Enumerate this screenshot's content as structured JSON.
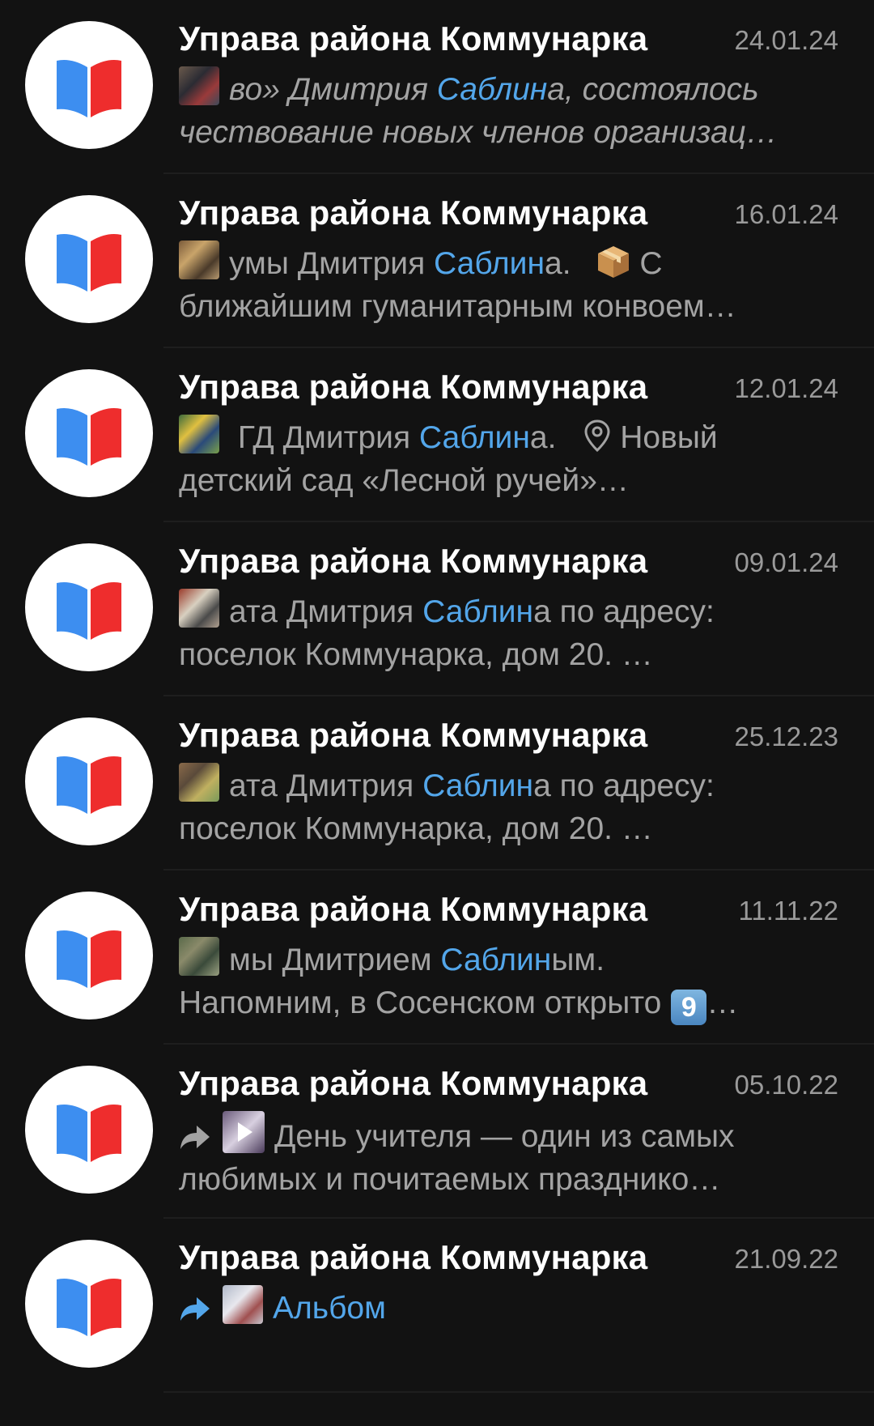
{
  "chats": [
    {
      "title": "Управа района Коммунарка",
      "date": "24.01.24",
      "line1_pre": "во» Дмитрия ",
      "line1_hl": "Саблин",
      "line1_post": "а, состоялось",
      "line2": "чествование новых членов организац…"
    },
    {
      "title": "Управа района Коммунарка",
      "date": "16.01.24",
      "line1_pre": "умы Дмитрия ",
      "line1_hl": "Саблин",
      "line1_post": "а.",
      "line1_after": "С",
      "line2": "ближайшим гуманитарным конвоем…"
    },
    {
      "title": "Управа района Коммунарка",
      "date": "12.01.24",
      "line1_pre": "ГД Дмитрия ",
      "line1_hl": "Саблин",
      "line1_post": "а.",
      "line1_after": "Новый",
      "line2": "детский сад «Лесной ручей»…"
    },
    {
      "title": "Управа района Коммунарка",
      "date": "09.01.24",
      "line1_pre": "ата Дмитрия ",
      "line1_hl": "Саблин",
      "line1_post": "а по адресу:",
      "line2": "поселок Коммунарка, дом 20. …"
    },
    {
      "title": "Управа района Коммунарка",
      "date": "25.12.23",
      "line1_pre": "ата Дмитрия ",
      "line1_hl": "Саблин",
      "line1_post": "а по адресу:",
      "line2": "поселок Коммунарка, дом 20. …"
    },
    {
      "title": "Управа района Коммунарка",
      "date": "11.11.22",
      "line1_pre": "мы Дмитрием ",
      "line1_hl": "Саблин",
      "line1_post": "ым.",
      "line2": "Напомним, в Сосенском открыто",
      "line2_badge": "9",
      "line2_tail": "…"
    },
    {
      "title": "Управа района Коммунарка",
      "date": "05.10.22",
      "line1_pre": "День учителя — один из самых",
      "line2": "любимых и почитаемых празднико…"
    },
    {
      "title": "Управа района Коммунарка",
      "date": "21.09.22",
      "line1_pre": "Альбом"
    }
  ],
  "colors": {
    "background": "#121212",
    "title": "#ffffff",
    "snippet": "#a3a3a3",
    "highlight": "#53a6ea",
    "avatar_book_left": "#3d8ef0",
    "avatar_book_right": "#ee2d2d"
  },
  "icons": {
    "avatar": "book-logo-icon",
    "forward": "forward-arrow-icon",
    "package": "package-emoji-icon",
    "location": "location-pin-icon",
    "keycap": "keycap-nine-icon",
    "video": "video-thumbnail-icon"
  }
}
